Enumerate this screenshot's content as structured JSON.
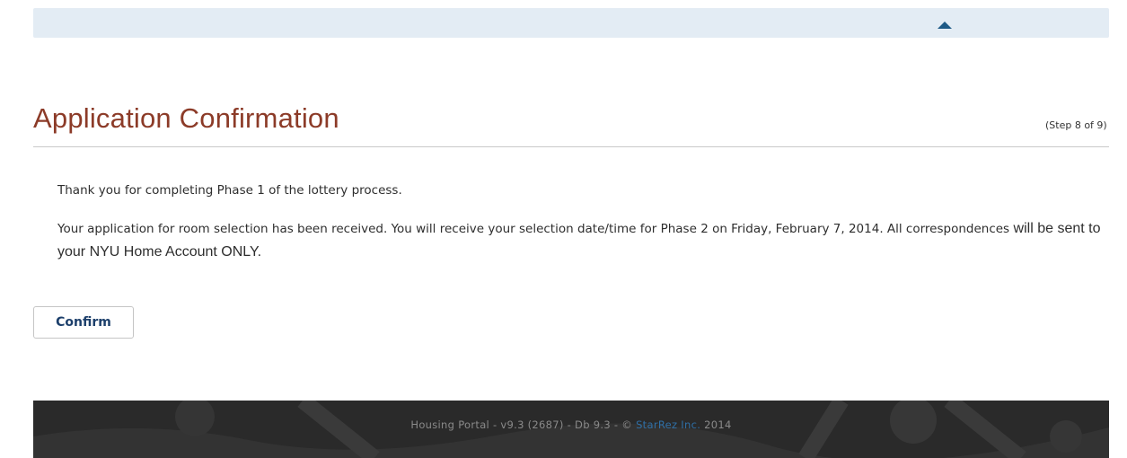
{
  "header": {
    "collapse_icon": "caret-up-icon"
  },
  "page": {
    "title": "Application Confirmation",
    "step_indicator": "(Step 8 of 9)"
  },
  "content": {
    "paragraph1": "Thank you for completing Phase 1 of the lottery process.",
    "paragraph2_part1": "Your application for room selection has been received. You will receive your selection date/time for Phase 2 on Friday, February 7, 2014. All correspondences",
    "paragraph2_part2": " will be sent to your NYU Home Account ONLY."
  },
  "actions": {
    "confirm_label": "Confirm"
  },
  "footer": {
    "text_before": "Housing Portal - v9.3 (2687) - Db 9.3 - © ",
    "link_text": "StarRez Inc.",
    "text_after": " 2014"
  },
  "colors": {
    "title": "#8c3b28",
    "topbar": "#e3ecf4",
    "caret": "#1e5a86",
    "button_text": "#1c3f6b",
    "footer_bg": "#2b2b2b",
    "footer_link": "#2f6fa6"
  }
}
